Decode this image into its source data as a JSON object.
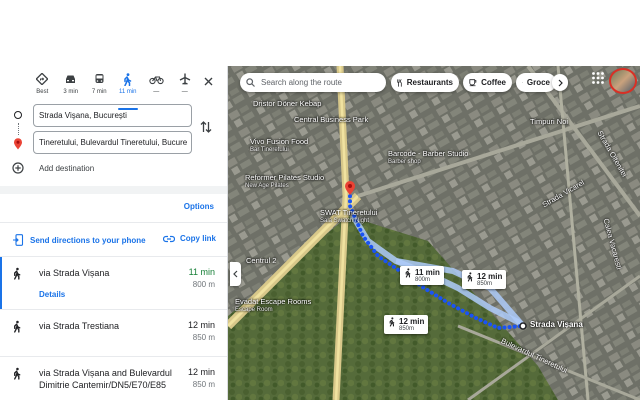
{
  "modes": [
    {
      "label": "Best",
      "icon": "diamond-directions-icon"
    },
    {
      "label": "3 min",
      "icon": "car-icon"
    },
    {
      "label": "7 min",
      "icon": "transit-icon"
    },
    {
      "label": "11 min",
      "icon": "walk-icon"
    },
    {
      "label": "—",
      "icon": "bicycle-icon"
    },
    {
      "label": "—",
      "icon": "plane-icon"
    }
  ],
  "origin": {
    "value": "Strada Vişana, București"
  },
  "destination": {
    "value": "Tineretului, Bulevardul Tineretului, Bucure"
  },
  "add_destination": "Add destination",
  "options": "Options",
  "send_directions": "Send directions to your phone",
  "copy_link": "Copy link",
  "routes": [
    {
      "via": "via Strada Vișana",
      "time": "11 min",
      "dist": "800 m",
      "details": "Details"
    },
    {
      "via": "via Strada Trestiana",
      "time": "12 min",
      "dist": "850 m"
    },
    {
      "via": "via Strada Vișana and Bulevardul Dimitrie Cantemir/DN5/E70/E85",
      "time": "12 min",
      "dist": "850 m"
    }
  ],
  "map": {
    "search_placeholder": "Search along the route",
    "chips": [
      "Restaurants",
      "Coffee",
      "Groce"
    ],
    "pois": [
      {
        "name": "Dristor Döner Kebap",
        "sub": ""
      },
      {
        "name": "Central Business Park",
        "sub": ""
      },
      {
        "name": "Vivo Fusion Food",
        "sub": "Bar Tineretului"
      },
      {
        "name": "Barcode - Barber Studio",
        "sub": "Barber shop"
      },
      {
        "name": "Reformer Pilates Studio",
        "sub": "New Age Pilates"
      },
      {
        "name": "SWAT Tineretului",
        "sub": "Sala Swatch Night"
      },
      {
        "name": "Centrul 2",
        "sub": ""
      },
      {
        "name": "Evadat Escape Rooms",
        "sub": "Escape Room"
      },
      {
        "name": "Strada Vicarel",
        "sub": ""
      },
      {
        "name": "Timpuri Noi",
        "sub": ""
      },
      {
        "name": "Strada Oltenitei",
        "sub": ""
      },
      {
        "name": "Calea Vacaresti",
        "sub": ""
      },
      {
        "name": "Bulevardul Tineretului",
        "sub": ""
      }
    ],
    "cards": [
      {
        "time": "11 min",
        "dist": "800m"
      },
      {
        "time": "12 min",
        "dist": "850m"
      },
      {
        "time": "12 min",
        "dist": "850m"
      }
    ],
    "destination_label": "Strada Vișana"
  }
}
